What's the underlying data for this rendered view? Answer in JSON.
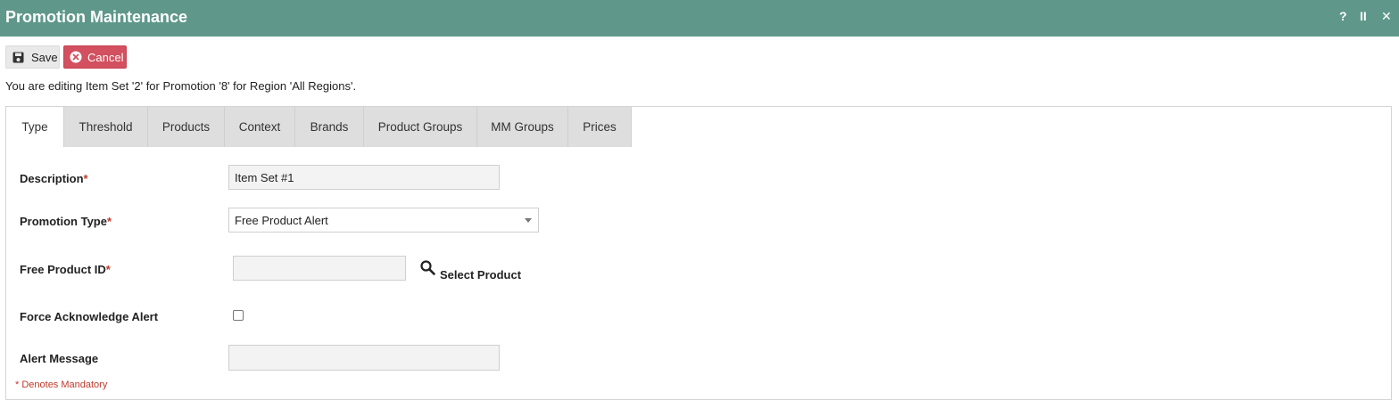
{
  "window": {
    "title": "Promotion Maintenance",
    "controls": [
      "?",
      "II",
      "✕"
    ]
  },
  "toolbar": {
    "save_label": "Save",
    "cancel_label": "Cancel"
  },
  "editing_message": "You are editing Item Set '2' for Promotion '8' for Region 'All Regions'.",
  "tabs": [
    {
      "label": "Type",
      "active": true
    },
    {
      "label": "Threshold",
      "active": false
    },
    {
      "label": "Products",
      "active": false
    },
    {
      "label": "Context",
      "active": false
    },
    {
      "label": "Brands",
      "active": false
    },
    {
      "label": "Product Groups",
      "active": false
    },
    {
      "label": "MM Groups",
      "active": false
    },
    {
      "label": "Prices",
      "active": false
    }
  ],
  "form": {
    "description": {
      "label": "Description",
      "required_marker": "*",
      "value": "Item Set #1"
    },
    "promotion_type": {
      "label": "Promotion Type",
      "required_marker": "*",
      "value": "Free Product Alert"
    },
    "free_product_id": {
      "label": "Free Product ID",
      "required_marker": "*",
      "value": "",
      "select_label": "Select Product"
    },
    "force_ack": {
      "label": "Force Acknowledge Alert",
      "checked": false
    },
    "alert_message": {
      "label": "Alert Message",
      "value": ""
    }
  },
  "mandatory_note": "* Denotes Mandatory",
  "colors": {
    "titlebar": "#5f988a",
    "cancel_button": "#d2505f",
    "required": "#c0392b"
  }
}
